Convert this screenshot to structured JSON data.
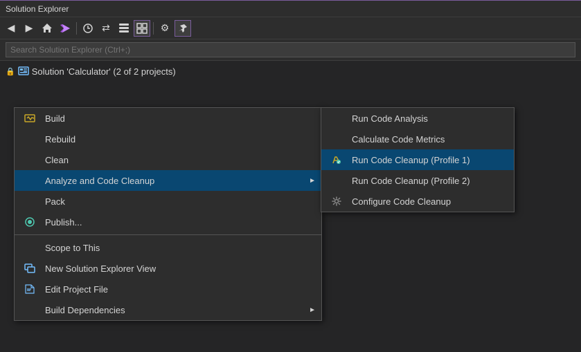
{
  "panel": {
    "title": "Solution Explorer",
    "search_placeholder": "Search Solution Explorer (Ctrl+;)"
  },
  "toolbar": {
    "buttons": [
      {
        "name": "back",
        "icon": "◀",
        "active": false
      },
      {
        "name": "forward",
        "icon": "▶",
        "active": false
      },
      {
        "name": "home",
        "icon": "⌂",
        "active": false
      },
      {
        "name": "vs-icon",
        "icon": "❖",
        "active": false
      },
      {
        "name": "history",
        "icon": "⟳",
        "active": false
      },
      {
        "name": "sync",
        "icon": "⇄",
        "active": false
      },
      {
        "name": "collapse",
        "icon": "⊟",
        "active": false
      },
      {
        "name": "view-toggle",
        "icon": "⊡",
        "active": true
      },
      {
        "name": "settings",
        "icon": "⚙",
        "active": false
      },
      {
        "name": "pin",
        "icon": "⊞",
        "active": true
      }
    ]
  },
  "tree": {
    "solution_label": "Solution 'Calculator' (2 of 2 projects)"
  },
  "context_menu": {
    "items": [
      {
        "id": "build",
        "label": "Build",
        "icon": "build",
        "has_submenu": false,
        "separator_before": false
      },
      {
        "id": "rebuild",
        "label": "Rebuild",
        "icon": "",
        "has_submenu": false,
        "separator_before": false
      },
      {
        "id": "clean",
        "label": "Clean",
        "icon": "",
        "has_submenu": false,
        "separator_before": false
      },
      {
        "id": "analyze",
        "label": "Analyze and Code Cleanup",
        "icon": "",
        "has_submenu": true,
        "highlighted": true,
        "separator_before": false
      },
      {
        "id": "pack",
        "label": "Pack",
        "icon": "",
        "has_submenu": false,
        "separator_before": false
      },
      {
        "id": "publish",
        "label": "Publish...",
        "icon": "publish",
        "has_submenu": false,
        "separator_before": false
      },
      {
        "id": "scope",
        "label": "Scope to This",
        "icon": "",
        "has_submenu": false,
        "separator_before": true
      },
      {
        "id": "new-explorer",
        "label": "New Solution Explorer View",
        "icon": "new-explorer",
        "has_submenu": false,
        "separator_before": false
      },
      {
        "id": "edit-project",
        "label": "Edit Project File",
        "icon": "edit-project",
        "has_submenu": false,
        "separator_before": false
      },
      {
        "id": "build-deps",
        "label": "Build Dependencies",
        "icon": "",
        "has_submenu": true,
        "separator_before": false
      }
    ]
  },
  "submenu": {
    "items": [
      {
        "id": "run-analysis",
        "label": "Run Code Analysis",
        "icon": "",
        "highlighted": false
      },
      {
        "id": "calc-metrics",
        "label": "Calculate Code Metrics",
        "icon": "",
        "highlighted": false
      },
      {
        "id": "run-cleanup-1",
        "label": "Run Code Cleanup (Profile 1)",
        "icon": "cleanup",
        "highlighted": true
      },
      {
        "id": "run-cleanup-2",
        "label": "Run Code Cleanup (Profile 2)",
        "icon": "",
        "highlighted": false
      },
      {
        "id": "configure",
        "label": "Configure Code Cleanup",
        "icon": "configure",
        "highlighted": false
      }
    ]
  }
}
